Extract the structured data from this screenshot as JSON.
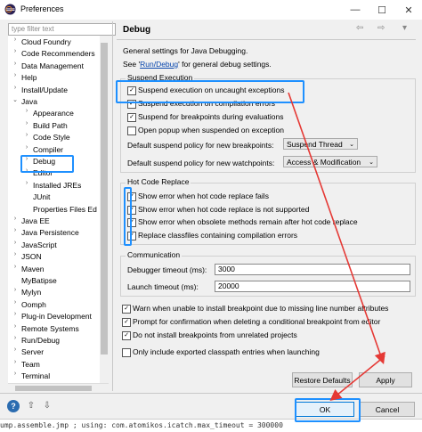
{
  "window": {
    "title": "Preferences",
    "min": "—",
    "max": "☐",
    "close": "✕"
  },
  "filter": {
    "placeholder": "type filter text"
  },
  "tree": {
    "items": [
      {
        "label": "Cloud Foundry",
        "arrow": "›"
      },
      {
        "label": "Code Recommenders",
        "arrow": "›"
      },
      {
        "label": "Data Management",
        "arrow": "›"
      },
      {
        "label": "Help",
        "arrow": "›"
      },
      {
        "label": "Install/Update",
        "arrow": "›"
      },
      {
        "label": "Java",
        "arrow": "⌄"
      },
      {
        "label": "Appearance",
        "arrow": "›"
      },
      {
        "label": "Build Path",
        "arrow": "›"
      },
      {
        "label": "Code Style",
        "arrow": "›"
      },
      {
        "label": "Compiler",
        "arrow": "›"
      },
      {
        "label": "Debug",
        "arrow": "›"
      },
      {
        "label": "Editor",
        "arrow": "›"
      },
      {
        "label": "Installed JREs",
        "arrow": "›"
      },
      {
        "label": "JUnit",
        "arrow": ""
      },
      {
        "label": "Properties Files Ed",
        "arrow": ""
      },
      {
        "label": "Java EE",
        "arrow": "›"
      },
      {
        "label": "Java Persistence",
        "arrow": "›"
      },
      {
        "label": "JavaScript",
        "arrow": "›"
      },
      {
        "label": "JSON",
        "arrow": "›"
      },
      {
        "label": "Maven",
        "arrow": "›"
      },
      {
        "label": "MyBatipse",
        "arrow": ""
      },
      {
        "label": "Mylyn",
        "arrow": "›"
      },
      {
        "label": "Oomph",
        "arrow": "›"
      },
      {
        "label": "Plug-in Development",
        "arrow": "›"
      },
      {
        "label": "Remote Systems",
        "arrow": "›"
      },
      {
        "label": "Run/Debug",
        "arrow": "›"
      },
      {
        "label": "Server",
        "arrow": "›"
      },
      {
        "label": "Team",
        "arrow": "›"
      },
      {
        "label": "Terminal",
        "arrow": "›"
      }
    ]
  },
  "page": {
    "title": "Debug",
    "desc": "General settings for Java Debugging.",
    "see_prefix": "See '",
    "see_link": "Run/Debug",
    "see_suffix": "' for general debug settings.",
    "nav_back": "⇦",
    "nav_fwd": "⇨",
    "nav_menu": "▾"
  },
  "suspend": {
    "legend": "Suspend Execution",
    "options": [
      {
        "label": "Suspend execution on uncaught exceptions",
        "checked": true
      },
      {
        "label": "Suspend execution on compilation errors",
        "checked": true
      },
      {
        "label": "Suspend for breakpoints during evaluations",
        "checked": true
      },
      {
        "label": "Open popup when suspended on exception",
        "checked": false
      }
    ],
    "policy_bp_label": "Default suspend policy for new breakpoints:",
    "policy_bp_value": "Suspend Thread",
    "policy_wp_label": "Default suspend policy for new watchpoints:",
    "policy_wp_value": "Access & Modification"
  },
  "hcr": {
    "legend": "Hot Code Replace",
    "options": [
      {
        "label": "Show error when hot code replace fails",
        "checked": true
      },
      {
        "label": "Show error when hot code replace is not supported",
        "checked": true
      },
      {
        "label": "Show error when obsolete methods remain after hot code replace",
        "checked": true
      },
      {
        "label": "Replace classfiles containing compilation errors",
        "checked": true
      }
    ]
  },
  "comm": {
    "legend": "Communication",
    "timeout_label": "Debugger timeout (ms):",
    "timeout_value": "3000",
    "launch_label": "Launch timeout (ms):",
    "launch_value": "20000"
  },
  "misc": {
    "options": [
      {
        "label": "Warn when unable to install breakpoint due to missing line number attributes",
        "checked": true
      },
      {
        "label": "Prompt for confirmation when deleting a conditional breakpoint from editor",
        "checked": true
      },
      {
        "label": "Do not install breakpoints from unrelated projects",
        "checked": true
      },
      {
        "label": "Only include exported classpath entries when launching",
        "checked": false
      }
    ]
  },
  "buttons": {
    "restore": "Restore Defaults",
    "apply": "Apply",
    "ok": "OK",
    "cancel": "Cancel"
  },
  "bottom": {
    "help": "?",
    "import": "⇧",
    "export": "⇩"
  },
  "terminal": {
    "text": "ump.assemble.jmp     ; using: com.atomikos.icatch.max_timeout = 300000"
  },
  "colors": {
    "highlight": "#1e90ff",
    "arrow": "#e53935",
    "link": "#0645ad"
  }
}
